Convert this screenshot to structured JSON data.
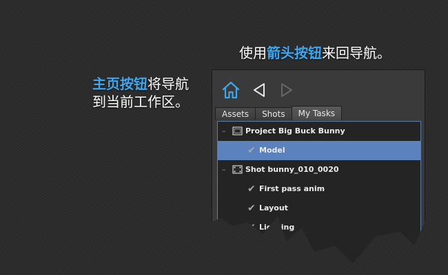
{
  "captions": {
    "nav_highlight": "箭头按钮",
    "nav_prefix": "使用",
    "nav_suffix": "来回导航。",
    "home_highlight": "主页按钮",
    "home_line1_rest": "将导航",
    "home_line2": "到当前工作区。"
  },
  "toolbar": {
    "home_icon": "home-icon",
    "back_icon": "arrow-left-icon",
    "forward_icon": "arrow-right-icon"
  },
  "tabs": [
    {
      "label": "Assets",
      "active": false
    },
    {
      "label": "Shots",
      "active": false
    },
    {
      "label": "My Tasks",
      "active": true
    }
  ],
  "tree": [
    {
      "type": "group",
      "label": "Project Big Buck Bunny",
      "icon": "project-icon"
    },
    {
      "type": "task",
      "label": "Model",
      "selected": true
    },
    {
      "type": "group",
      "label": "Shot bunny_010_0020",
      "icon": "shot-icon"
    },
    {
      "type": "task",
      "label": "First pass anim"
    },
    {
      "type": "task",
      "label": "Layout"
    },
    {
      "type": "task",
      "label": "Lighting"
    }
  ],
  "colors": {
    "highlight": "#3fa7f0",
    "selection": "#5b82bc"
  }
}
